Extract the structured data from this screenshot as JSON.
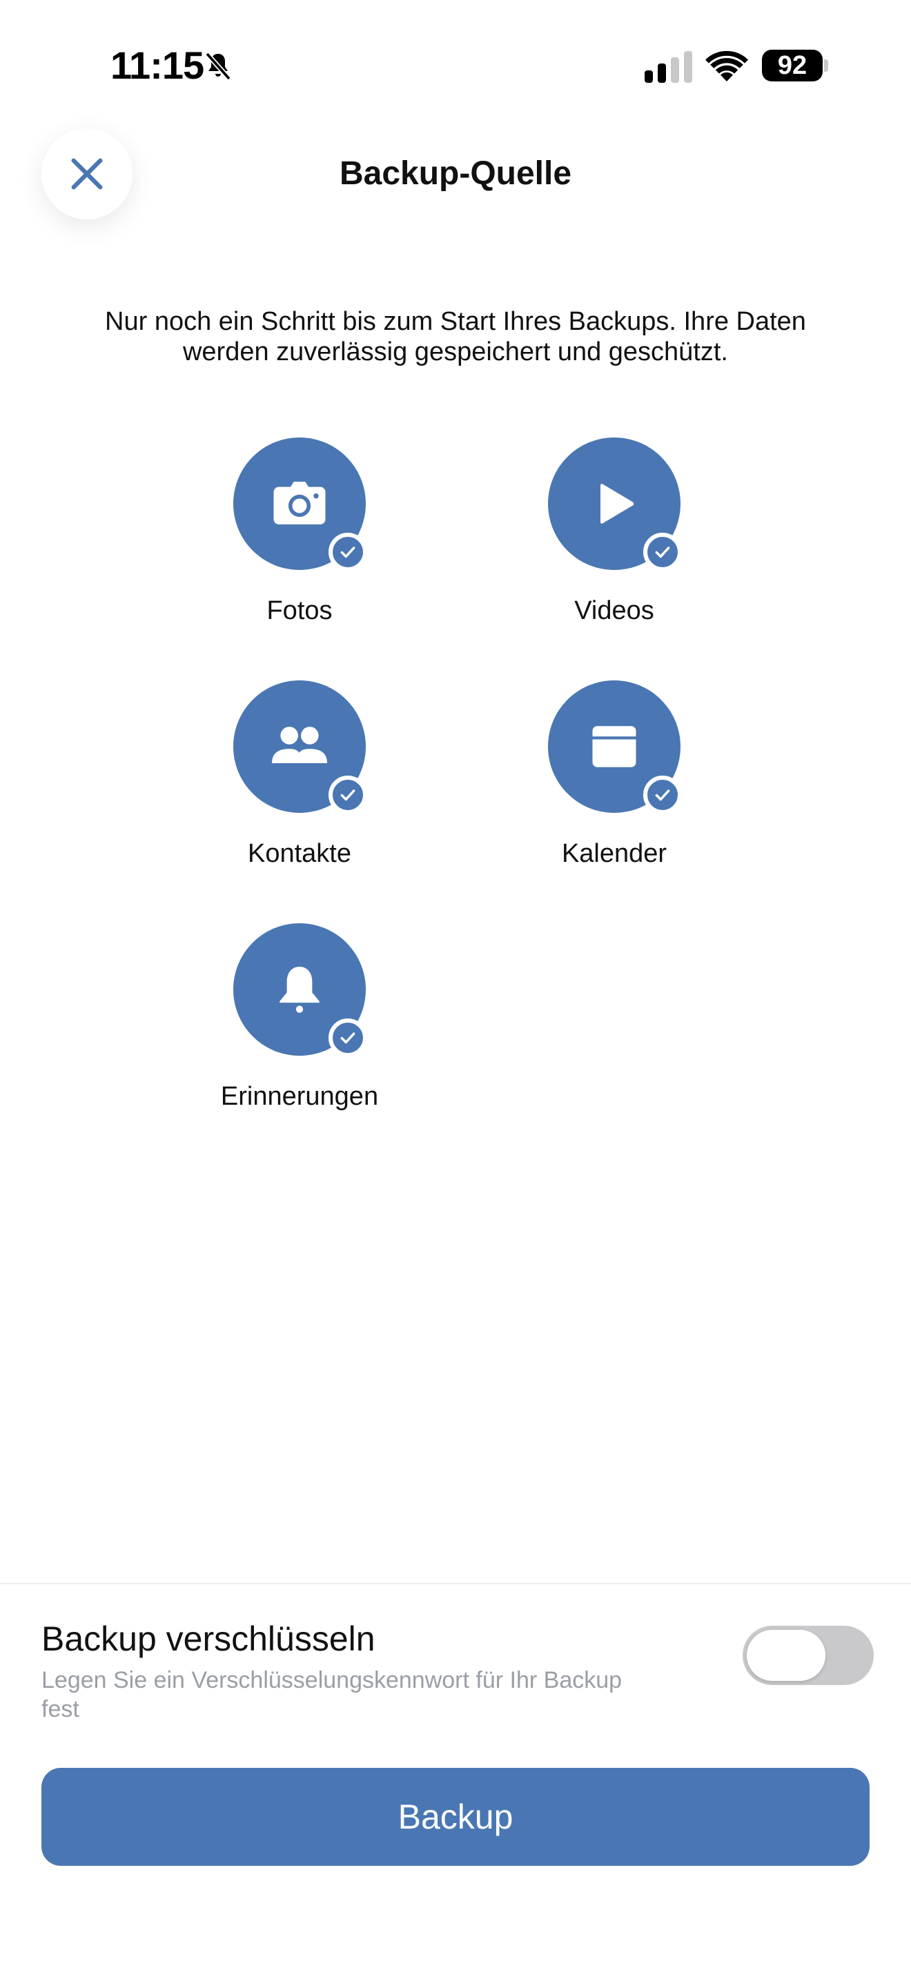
{
  "status_bar": {
    "time": "11:15",
    "battery": "92",
    "icons": [
      "bell-slash-icon",
      "cellular-signal-icon",
      "wifi-icon",
      "battery-icon"
    ]
  },
  "header": {
    "title": "Backup-Quelle",
    "close_icon": "close-icon"
  },
  "description": "Nur noch ein Schritt bis zum Start Ihres Backups. Ihre Daten werden zuverlässig gespeichert und geschützt.",
  "sources": [
    {
      "label": "Fotos",
      "icon": "camera-icon",
      "selected": true
    },
    {
      "label": "Videos",
      "icon": "play-icon",
      "selected": true
    },
    {
      "label": "Kontakte",
      "icon": "contacts-icon",
      "selected": true
    },
    {
      "label": "Kalender",
      "icon": "calendar-icon",
      "selected": true
    },
    {
      "label": "Erinnerungen",
      "icon": "bell-icon",
      "selected": true
    }
  ],
  "encryption": {
    "title": "Backup verschlüsseln",
    "description": "Legen Sie ein Verschlüsselungskennwort für Ihr Backup fest",
    "enabled": false
  },
  "backup_button_label": "Backup",
  "colors": {
    "accent": "#4a77b3",
    "toggle_off": "#c9c9cc",
    "secondary_text": "#9a9ea6"
  }
}
